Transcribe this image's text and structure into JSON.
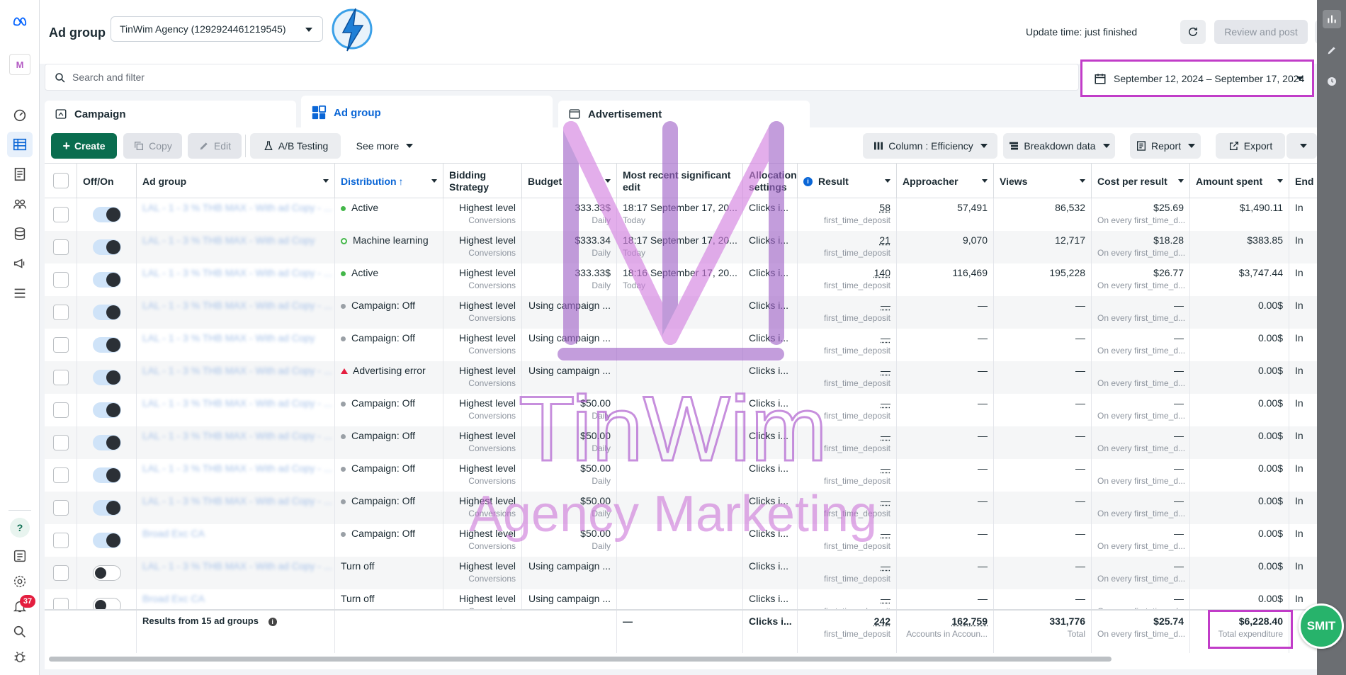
{
  "header": {
    "title": "Ad group",
    "account": "TinWim Agency (1292924461219545)",
    "update_time": "Update time: just finished",
    "review_label": "Review and post",
    "more_label": "···"
  },
  "search": {
    "placeholder": "Search and filter"
  },
  "date_range": "September 12, 2024 – September 17, 2024",
  "tabs": [
    {
      "label": "Campaign"
    },
    {
      "label": "Ad group"
    },
    {
      "label": "Advertisement"
    }
  ],
  "toolbar": {
    "create": "Create",
    "copy": "Copy",
    "edit": "Edit",
    "ab_testing": "A/B Testing",
    "see_more": "See more",
    "column": "Column : Efficiency",
    "breakdown": "Breakdown data",
    "report": "Report",
    "export": "Export"
  },
  "columns": {
    "offon": "Off/On",
    "adgroup": "Ad group",
    "distribution": "Distribution",
    "bidding": "Bidding Strategy",
    "budget": "Budget",
    "edit": "Most recent significant edit",
    "allocation": "Allocation settings",
    "result": "Result",
    "approacher": "Approacher",
    "views": "Views",
    "cpr": "Cost per result",
    "amount": "Amount spent",
    "end": "End"
  },
  "rows": [
    {
      "name": "LAL - 1 - 3 % THB MAX - With ad Copy - ...",
      "on": true,
      "status": "Active",
      "dot": "green",
      "bid": "Highest level",
      "bid_sub": "Conversions",
      "budget": "333.33$",
      "budget_sub": "Daily",
      "edit": "18:17 September 17, 20...",
      "edit_sub": "Today",
      "alloc": "Clicks i...",
      "result": "58",
      "result_sub": "first_time_deposit",
      "approacher": "57,491",
      "views": "86,532",
      "cpr": "$25.69",
      "cpr_sub": "On every first_time_d...",
      "amount": "$1,490.11",
      "end": "In"
    },
    {
      "name": "LAL - 1 - 3 % THB MAX - With ad Copy",
      "on": true,
      "status": "Machine learning",
      "dot": "ml",
      "bid": "Highest level",
      "bid_sub": "Conversions",
      "budget": "$333.34",
      "budget_sub": "Daily",
      "edit": "18:17 September 17, 20...",
      "edit_sub": "Today",
      "alloc": "Clicks i...",
      "result": "21",
      "result_sub": "first_time_deposit",
      "approacher": "9,070",
      "views": "12,717",
      "cpr": "$18.28",
      "cpr_sub": "On every first_time_d...",
      "amount": "$383.85",
      "end": "In"
    },
    {
      "name": "LAL - 1 - 3 % THB MAX - With ad Copy - ...",
      "on": true,
      "status": "Active",
      "dot": "green",
      "bid": "Highest level",
      "bid_sub": "Conversions",
      "budget": "333.33$",
      "budget_sub": "Daily",
      "edit": "18:16 September 17, 20...",
      "edit_sub": "Today",
      "alloc": "Clicks i...",
      "result": "140",
      "result_sub": "first_time_deposit",
      "approacher": "116,469",
      "views": "195,228",
      "cpr": "$26.77",
      "cpr_sub": "On every first_time_d...",
      "amount": "$3,747.44",
      "end": "In"
    },
    {
      "name": "LAL - 1 - 3 % THB MAX - With ad Copy - ...",
      "on": true,
      "status": "Campaign: Off",
      "dot": "grey",
      "bid": "Highest level",
      "bid_sub": "Conversions",
      "budget": "Using campaign ...",
      "budget_sub": "",
      "edit": "",
      "edit_sub": "",
      "alloc": "Clicks i...",
      "result": "—",
      "result_sub": "first_time_deposit",
      "approacher": "—",
      "views": "—",
      "cpr": "—",
      "cpr_sub": "On every first_time_d...",
      "amount": "0.00$",
      "end": "In"
    },
    {
      "name": "LAL - 1 - 3 % THB MAX - With ad Copy",
      "on": true,
      "status": "Campaign: Off",
      "dot": "grey",
      "bid": "Highest level",
      "bid_sub": "Conversions",
      "budget": "Using campaign ...",
      "budget_sub": "",
      "edit": "",
      "edit_sub": "",
      "alloc": "Clicks i...",
      "result": "—",
      "result_sub": "first_time_deposit",
      "approacher": "—",
      "views": "—",
      "cpr": "—",
      "cpr_sub": "On every first_time_d...",
      "amount": "0.00$",
      "end": "In"
    },
    {
      "name": "LAL - 1 - 3 % THB MAX - With ad Copy - ...",
      "on": true,
      "status": "Advertising error",
      "dot": "tri",
      "bid": "Highest level",
      "bid_sub": "Conversions",
      "budget": "Using campaign ...",
      "budget_sub": "",
      "edit": "",
      "edit_sub": "",
      "alloc": "Clicks i...",
      "result": "—",
      "result_sub": "first_time_deposit",
      "approacher": "—",
      "views": "—",
      "cpr": "—",
      "cpr_sub": "On every first_time_d...",
      "amount": "0.00$",
      "end": "In"
    },
    {
      "name": "LAL - 1 - 3 % THB MAX - With ad Copy - ...",
      "on": true,
      "status": "Campaign: Off",
      "dot": "grey",
      "bid": "Highest level",
      "bid_sub": "Conversions",
      "budget": "$50.00",
      "budget_sub": "Daily",
      "edit": "",
      "edit_sub": "",
      "alloc": "Clicks i...",
      "result": "—",
      "result_sub": "first_time_deposit",
      "approacher": "—",
      "views": "—",
      "cpr": "—",
      "cpr_sub": "On every first_time_d...",
      "amount": "0.00$",
      "end": "In"
    },
    {
      "name": "LAL - 1 - 3 % THB MAX - With ad Copy - ...",
      "on": true,
      "status": "Campaign: Off",
      "dot": "grey",
      "bid": "Highest level",
      "bid_sub": "Conversions",
      "budget": "$50.00",
      "budget_sub": "Daily",
      "edit": "",
      "edit_sub": "",
      "alloc": "Clicks i...",
      "result": "—",
      "result_sub": "first_time_deposit",
      "approacher": "—",
      "views": "—",
      "cpr": "—",
      "cpr_sub": "On every first_time_d...",
      "amount": "0.00$",
      "end": "In"
    },
    {
      "name": "LAL - 1 - 3 % THB MAX - With ad Copy - ...",
      "on": true,
      "status": "Campaign: Off",
      "dot": "grey",
      "bid": "Highest level",
      "bid_sub": "Conversions",
      "budget": "$50.00",
      "budget_sub": "Daily",
      "edit": "",
      "edit_sub": "",
      "alloc": "Clicks i...",
      "result": "—",
      "result_sub": "first_time_deposit",
      "approacher": "—",
      "views": "—",
      "cpr": "—",
      "cpr_sub": "On every first_time_d...",
      "amount": "0.00$",
      "end": "In"
    },
    {
      "name": "LAL - 1 - 3 % THB MAX - With ad Copy - ...",
      "on": true,
      "status": "Campaign: Off",
      "dot": "grey",
      "bid": "Highest level",
      "bid_sub": "Conversions",
      "budget": "$50.00",
      "budget_sub": "Daily",
      "edit": "",
      "edit_sub": "",
      "alloc": "Clicks i...",
      "result": "—",
      "result_sub": "first_time_deposit",
      "approacher": "—",
      "views": "—",
      "cpr": "—",
      "cpr_sub": "On every first_time_d...",
      "amount": "0.00$",
      "end": "In"
    },
    {
      "name": "Broad Exc CA",
      "on": true,
      "status": "Campaign: Off",
      "dot": "grey",
      "bid": "Highest level",
      "bid_sub": "Conversions",
      "budget": "$50.00",
      "budget_sub": "Daily",
      "edit": "",
      "edit_sub": "",
      "alloc": "Clicks i...",
      "result": "—",
      "result_sub": "first_time_deposit",
      "approacher": "—",
      "views": "—",
      "cpr": "—",
      "cpr_sub": "On every first_time_d...",
      "amount": "0.00$",
      "end": "In"
    },
    {
      "name": "LAL - 1 - 3 % THB MAX - With ad Copy - ...",
      "on": false,
      "status": "Turn off",
      "dot": "",
      "bid": "Highest level",
      "bid_sub": "Conversions",
      "budget": "Using campaign ...",
      "budget_sub": "",
      "edit": "",
      "edit_sub": "",
      "alloc": "Clicks i...",
      "result": "—",
      "result_sub": "first_time_deposit",
      "approacher": "—",
      "views": "—",
      "cpr": "—",
      "cpr_sub": "On every first_time_d...",
      "amount": "0.00$",
      "end": "In"
    },
    {
      "name": "Broad Exc CA",
      "on": false,
      "status": "Turn off",
      "dot": "",
      "bid": "Highest level",
      "bid_sub": "Conversions",
      "budget": "Using campaign ...",
      "budget_sub": "",
      "edit": "",
      "edit_sub": "",
      "alloc": "Clicks i...",
      "result": "—",
      "result_sub": "first_time_deposit",
      "approacher": "—",
      "views": "—",
      "cpr": "—",
      "cpr_sub": "On every first_time_d...",
      "amount": "0.00$",
      "end": "In"
    }
  ],
  "footer": {
    "label": "Results from 15 ad groups",
    "edit": "—",
    "alloc": "Clicks i...",
    "result": "242",
    "result_sub": "first_time_deposit",
    "approacher": "162,759",
    "approacher_sub": "Accounts in Accoun...",
    "views": "331,776",
    "views_sub": "Total",
    "cpr": "$25.74",
    "cpr_sub": "On every first_time_d...",
    "amount": "$6,228.40",
    "amount_sub": "Total expenditure"
  },
  "watermark": {
    "line1": "TinWim",
    "line2": "Agency Marketing"
  },
  "badge": "37",
  "smit": "SMIT",
  "colors": {
    "create": "#0a6d4f",
    "highlight": "#c13cc8",
    "link": "#0a66d6",
    "watermark": "#c86ad6"
  }
}
